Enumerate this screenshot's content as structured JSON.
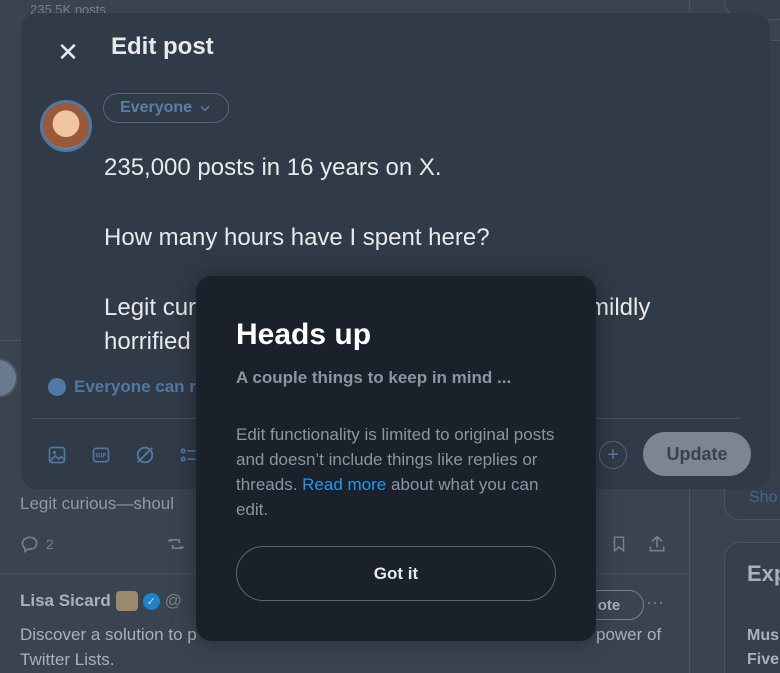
{
  "background": {
    "feed_count_text": "235.5K posts",
    "snippet_text": "Legit curious—shoul",
    "actions": {
      "reply_count": "2"
    },
    "tweet": {
      "author_name": "Lisa Sicard",
      "handle_fragment": "@",
      "vote_label": "ote",
      "text": "Discover a solution to p",
      "text_end": "power of",
      "text_line2": "Twitter Lists."
    },
    "right_column": {
      "explore_fragment": "Exp",
      "show_fragment": "Sho",
      "music_fragment": "Mus",
      "five_fragment": "Five"
    }
  },
  "modal": {
    "title": "Edit post",
    "audience_label": "Everyone",
    "post_lines": [
      "235,000 posts in 16 years on X.",
      "How many hours have I spent here?",
      "Legit curious—should I be proud or mildly horrified?"
    ],
    "visible_line3a": "Legit cur",
    "visible_line3b": "mildly",
    "visible_line3c": "horrified",
    "reply_setting": "Everyone can r",
    "update_label": "Update"
  },
  "popup": {
    "title": "Heads up",
    "subtitle": "A couple things to keep in mind ...",
    "body_before_link": "Edit functionality is limited to original posts and doesn’t include things like replies or threads. ",
    "link_text": "Read more",
    "body_after_link": " about what you can edit.",
    "button_label": "Got it"
  },
  "colors": {
    "accent": "#1d9bf0",
    "modal_bg": "#313a47",
    "popup_bg": "#1a212b"
  }
}
